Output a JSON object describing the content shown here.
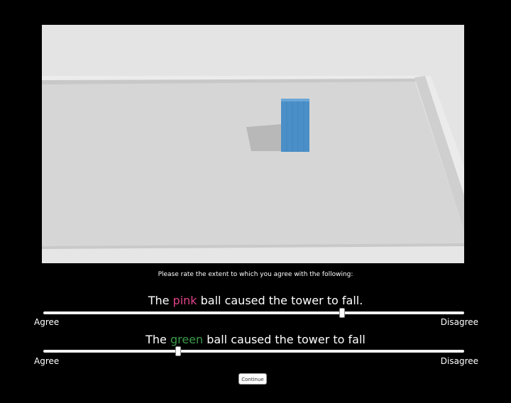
{
  "prompt": "Please rate the extent to which you agree with the following:",
  "questions": [
    {
      "prefix": "The ",
      "highlight": "pink",
      "highlight_color": "#e0448a",
      "suffix": " ball caused the tower to fall.",
      "left_label": "Agree",
      "right_label": "Disagree",
      "value_percent": 71
    },
    {
      "prefix": "The ",
      "highlight": "green",
      "highlight_color": "#3b9a4a",
      "suffix": " ball caused the tower to fall",
      "left_label": "Agree",
      "right_label": "Disagree",
      "value_percent": 32
    }
  ],
  "continue_label": "Continue",
  "colors": {
    "background": "#000000",
    "floor": "#d9d9d9",
    "block": "#4a8fc7"
  }
}
